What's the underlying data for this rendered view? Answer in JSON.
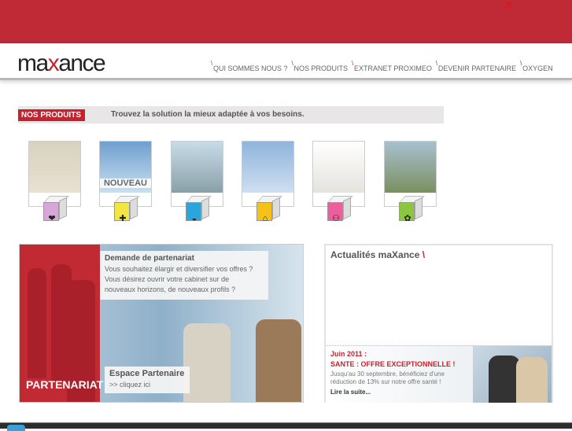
{
  "header": {
    "close_icon": "close-x"
  },
  "logo": {
    "text": "maXance"
  },
  "nav": [
    {
      "label": "QUI SOMMES NOUS ?"
    },
    {
      "label": "NOS PRODUITS"
    },
    {
      "label": "EXTRANET PROXIMEO"
    },
    {
      "label": "DEVENIR PARTENAIRE"
    },
    {
      "label": "OXYGEN"
    }
  ],
  "products_bar": {
    "tag": "NOS PRODUITS",
    "text": "Trouvez la solution la mieux adaptée à vos besoins."
  },
  "products": [
    {
      "name": "couple-car",
      "icon": "couple-icon",
      "color": "#d9a6d9",
      "badge": ""
    },
    {
      "name": "health",
      "icon": "health-cross-icon",
      "color": "#f2e640",
      "badge": "NOUVEAU"
    },
    {
      "name": "scooter",
      "icon": "helmet-icon",
      "color": "#2aa6dc",
      "badge": ""
    },
    {
      "name": "house",
      "icon": "house-icon",
      "color": "#f5c21a",
      "badge": ""
    },
    {
      "name": "car",
      "icon": "car-icon",
      "color": "#ee5d9c",
      "badge": ""
    },
    {
      "name": "pets",
      "icon": "paw-icon",
      "color": "#8cc63f",
      "badge": ""
    }
  ],
  "partenariat": {
    "title": "PARTENARIAT",
    "box_title": "Demande de partenariat",
    "box_lines": [
      "Vous souhaitez élargir et diversifier vos offres ?",
      "Vous désirez ouvrir votre cabinet sur de",
      "nouveaux horizons, de nouveaux profils ?"
    ],
    "espace_title": "Espace Partenaire",
    "espace_link": ">> cliquez ici"
  },
  "news": {
    "title": "Actualités maXance",
    "title_mark": "\\",
    "date": "Juin 2011 :",
    "headline": "SANTE : OFFRE EXCEPTIONNELLE !",
    "body1": "Jusqu'au 30 septembre, bénéficiez d'une",
    "body2": "réduction de 13% sur notre offre santé !",
    "more": "Lire la suite..."
  }
}
